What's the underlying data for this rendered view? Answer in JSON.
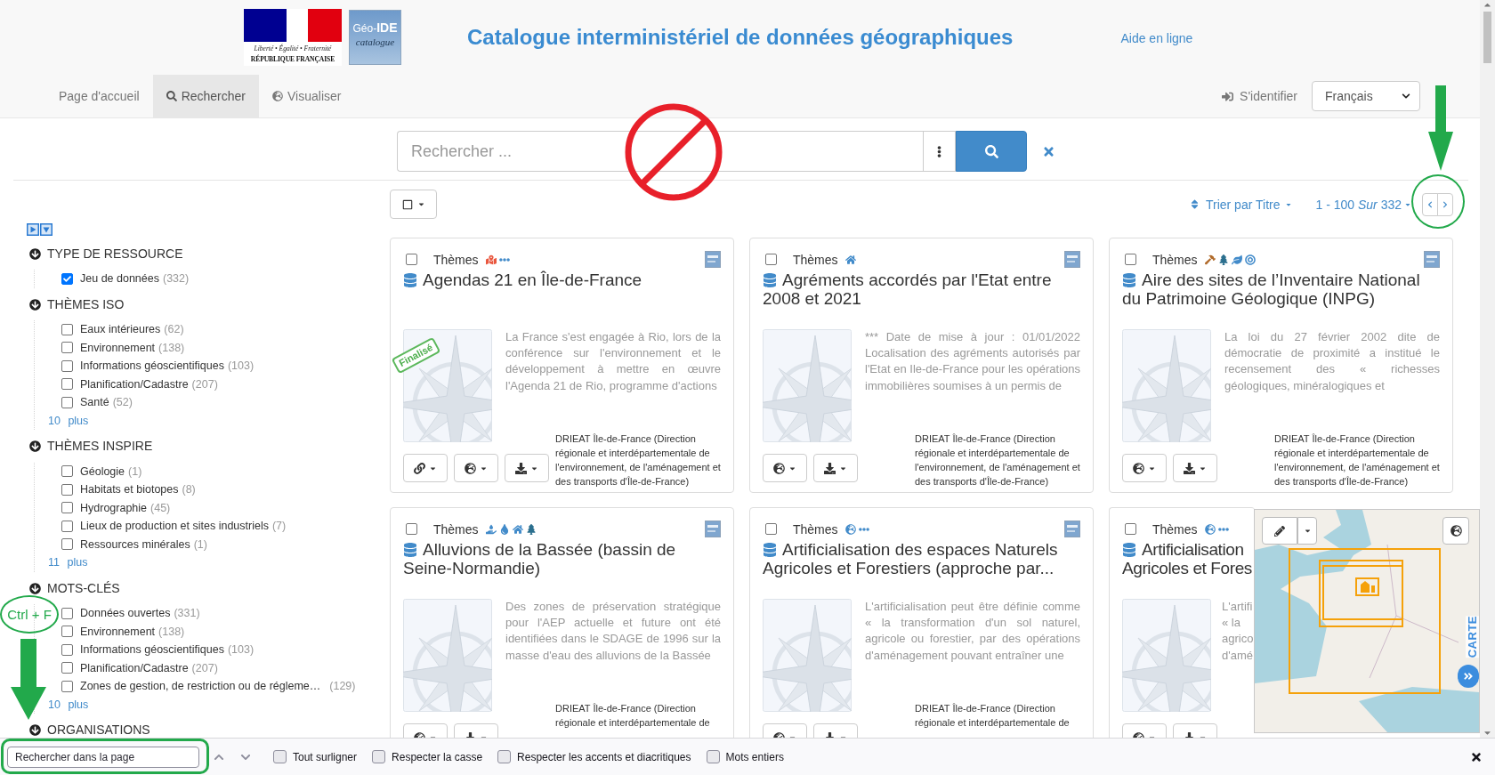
{
  "header": {
    "motto": "Liberté • Égalité • Fraternité",
    "republic": "RÉPUBLIQUE FRANÇAISE",
    "app_logo": "Géo-**IDE**",
    "app_logo_subtitle": "catalogue",
    "title": "Catalogue interministériel de données géographiques",
    "help_link": "Aide en ligne"
  },
  "nav": {
    "items": [
      {
        "label": "Page d'accueil",
        "kind": "home",
        "selected": false
      },
      {
        "label": "Rechercher",
        "kind": "search",
        "selected": true
      },
      {
        "label": "Visualiser",
        "kind": "view",
        "selected": false
      }
    ],
    "login": "S'identifier",
    "language": "Français"
  },
  "search": {
    "placeholder": "Rechercher ..."
  },
  "toolbar": {
    "select_all": {
      "checked": false
    },
    "sort": "Trier par Titre",
    "range": "1 - 100 *Sur* 332"
  },
  "facets": [
    {
      "title": "TYPE DE RESSOURCE",
      "expanded": true,
      "items": [
        {
          "label": "Jeu de données",
          "count": "(332)",
          "checked": true
        }
      ]
    },
    {
      "title": "THÈMES ISO",
      "expanded": true,
      "items": [
        {
          "label": "Eaux intérieures",
          "count": "(62)",
          "checked": false
        },
        {
          "label": "Environnement",
          "count": "(138)",
          "checked": false
        },
        {
          "label": "Informations géoscientifiques",
          "count": "(103)",
          "checked": false
        },
        {
          "label": "Planification/Cadastre",
          "count": "(207)",
          "checked": false
        },
        {
          "label": "Santé",
          "count": "(52)",
          "checked": false
        }
      ],
      "more": {
        "count": "10",
        "label": "plus"
      }
    },
    {
      "title": "THÈMES INSPIRE",
      "expanded": true,
      "items": [
        {
          "label": "Géologie",
          "count": "(1)",
          "checked": false
        },
        {
          "label": "Habitats et biotopes",
          "count": "(8)",
          "checked": false
        },
        {
          "label": "Hydrographie",
          "count": "(45)",
          "checked": false
        },
        {
          "label": "Lieux de production et sites industriels",
          "count": "(7)",
          "checked": false
        },
        {
          "label": "Ressources minérales",
          "count": "(1)",
          "checked": false
        }
      ],
      "more": {
        "count": "11",
        "label": "plus"
      }
    },
    {
      "title": "MOTS-CLÉS",
      "expanded": true,
      "items": [
        {
          "label": "Données ouvertes",
          "count": "(331)",
          "checked": false
        },
        {
          "label": "Environnement",
          "count": "(138)",
          "checked": false
        },
        {
          "label": "Informations géoscientifiques",
          "count": "(103)",
          "checked": false
        },
        {
          "label": "Planification/Cadastre",
          "count": "(207)",
          "checked": false
        },
        {
          "label": "Zones de gestion, de restriction ou de régleme…",
          "count": "(129)",
          "checked": false
        }
      ],
      "more": {
        "count": "10",
        "label": "plus"
      }
    },
    {
      "title": "ORGANISATIONS",
      "expanded": true
    }
  ],
  "results": [
    {
      "kind": "full",
      "checked": false,
      "themes_label": "Thèmes",
      "title": "Agendas 21 en Île-de-France",
      "status": "Finalisé",
      "description": "La France s'est engagée à Rio, lors de la conférence sur l'environnement et le développement à mettre en œuvre l'Agenda 21 de Rio, programme d'actions",
      "organization": "DRIEAT Île-de-France (Direction régionale et interdépartementale de l'environnement, de l'aménagement et des transports d'Île-de-France)",
      "actions": [
        {
          "kind": "links"
        },
        {
          "kind": "map"
        },
        {
          "kind": "download"
        }
      ]
    },
    {
      "kind": "full",
      "checked": false,
      "themes_label": "Thèmes",
      "title": "Agréments accordés par l'Etat entre 2008 et 2021",
      "description": "*** Date de mise à jour : 01/01/2022 Localisation des agréments autorisés par l'Etat en Ile-de-France pour les opérations immobilières soumises à un permis de",
      "organization": "DRIEAT Île-de-France (Direction régionale et interdépartementale de l'environnement, de l'aménagement et des transports d'Île-de-France)",
      "actions": [
        {
          "kind": "map"
        },
        {
          "kind": "download"
        }
      ]
    },
    {
      "kind": "full",
      "checked": false,
      "themes_label": "Thèmes",
      "title": "Aire des sites de l’Inventaire National du Patrimoine Géologique (INPG)",
      "description": "La loi du 27 février 2002 dite de démocratie de proximité a institué le recensement des « richesses géologiques, minéralogiques et",
      "organization": "DRIEAT Île-de-France (Direction régionale et interdépartementale de l'environnement, de l'aménagement et des transports d'Île-de-France)",
      "actions": [
        {
          "kind": "map"
        },
        {
          "kind": "download"
        }
      ]
    },
    {
      "kind": "full",
      "checked": false,
      "themes_label": "Thèmes",
      "title": "Alluvions de la Bassée (bassin de Seine-Normandie)",
      "description": "Des zones de préservation stratégique pour l'AEP actuelle et future ont été identifiées dans le SDAGE de 1996 sur la masse d'eau des alluvions de la Bassée",
      "organization": "DRIEAT Île-de-France (Direction régionale et interdépartementale de",
      "actions": [
        {
          "kind": "map"
        },
        {
          "kind": "download"
        }
      ]
    },
    {
      "kind": "full",
      "checked": false,
      "themes_label": "Thèmes",
      "title": "Artificialisation des espaces Naturels Agricoles et Forestiers (approche par...",
      "description": "L'artificialisation peut être définie comme « la transformation d'un sol naturel, agricole ou forestier, par des opérations d'aménagement pouvant entraîner une",
      "organization": "DRIEAT Île-de-France (Direction régionale et interdépartementale de",
      "actions": [
        {
          "kind": "map"
        },
        {
          "kind": "download"
        }
      ]
    },
    {
      "kind": "covered",
      "checked": false,
      "themes_label": "Thèmes",
      "title": "Artificialisation\nAgricoles et Fores",
      "description": "L'artifi\n« la\nagrico\nd'amé",
      "actions": [
        {
          "kind": "map"
        },
        {
          "kind": "download"
        }
      ]
    }
  ],
  "map": {
    "label": "CARTE"
  },
  "find_bar": {
    "placeholder": "Rechercher dans la page",
    "options": [
      {
        "label": "Tout surligner",
        "checked": false
      },
      {
        "label": "Respecter la casse",
        "checked": false
      },
      {
        "label": "Respecter les accents et diacritiques",
        "checked": false
      },
      {
        "label": "Mots entiers",
        "checked": false
      }
    ]
  },
  "annotation": {
    "shortcut": "Ctrl + F"
  }
}
